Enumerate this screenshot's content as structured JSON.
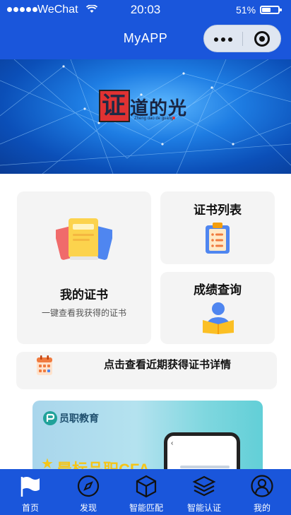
{
  "status": {
    "carrier": "WeChat",
    "time": "20:03",
    "battery": "51%"
  },
  "nav": {
    "title": "MyAPP"
  },
  "banner": {
    "logo_char": "证",
    "logo_text": "道的光",
    "logo_sub": "Zheng dao de guang"
  },
  "cards": {
    "my_certs": {
      "title": "我的证书",
      "subtitle": "一键查看我获得的证书"
    },
    "cert_list": {
      "title": "证书列表"
    },
    "score_query": {
      "title": "成绩查询"
    },
    "recent": {
      "title": "点击查看近期获得证书详情"
    }
  },
  "promo": {
    "brand": "员职教育",
    "headline": "晨标品职CFA"
  },
  "tabbar": {
    "items": [
      {
        "label": "首页",
        "icon": "flag-icon",
        "active": true
      },
      {
        "label": "发现",
        "icon": "compass-icon",
        "active": false
      },
      {
        "label": "智能匹配",
        "icon": "cube-icon",
        "active": false
      },
      {
        "label": "智能认证",
        "icon": "layers-icon",
        "active": false
      },
      {
        "label": "我的",
        "icon": "user-icon",
        "active": false
      }
    ]
  },
  "colors": {
    "primary": "#1a56db",
    "card_bg": "#f4f4f4",
    "logo_red": "#e03232"
  }
}
